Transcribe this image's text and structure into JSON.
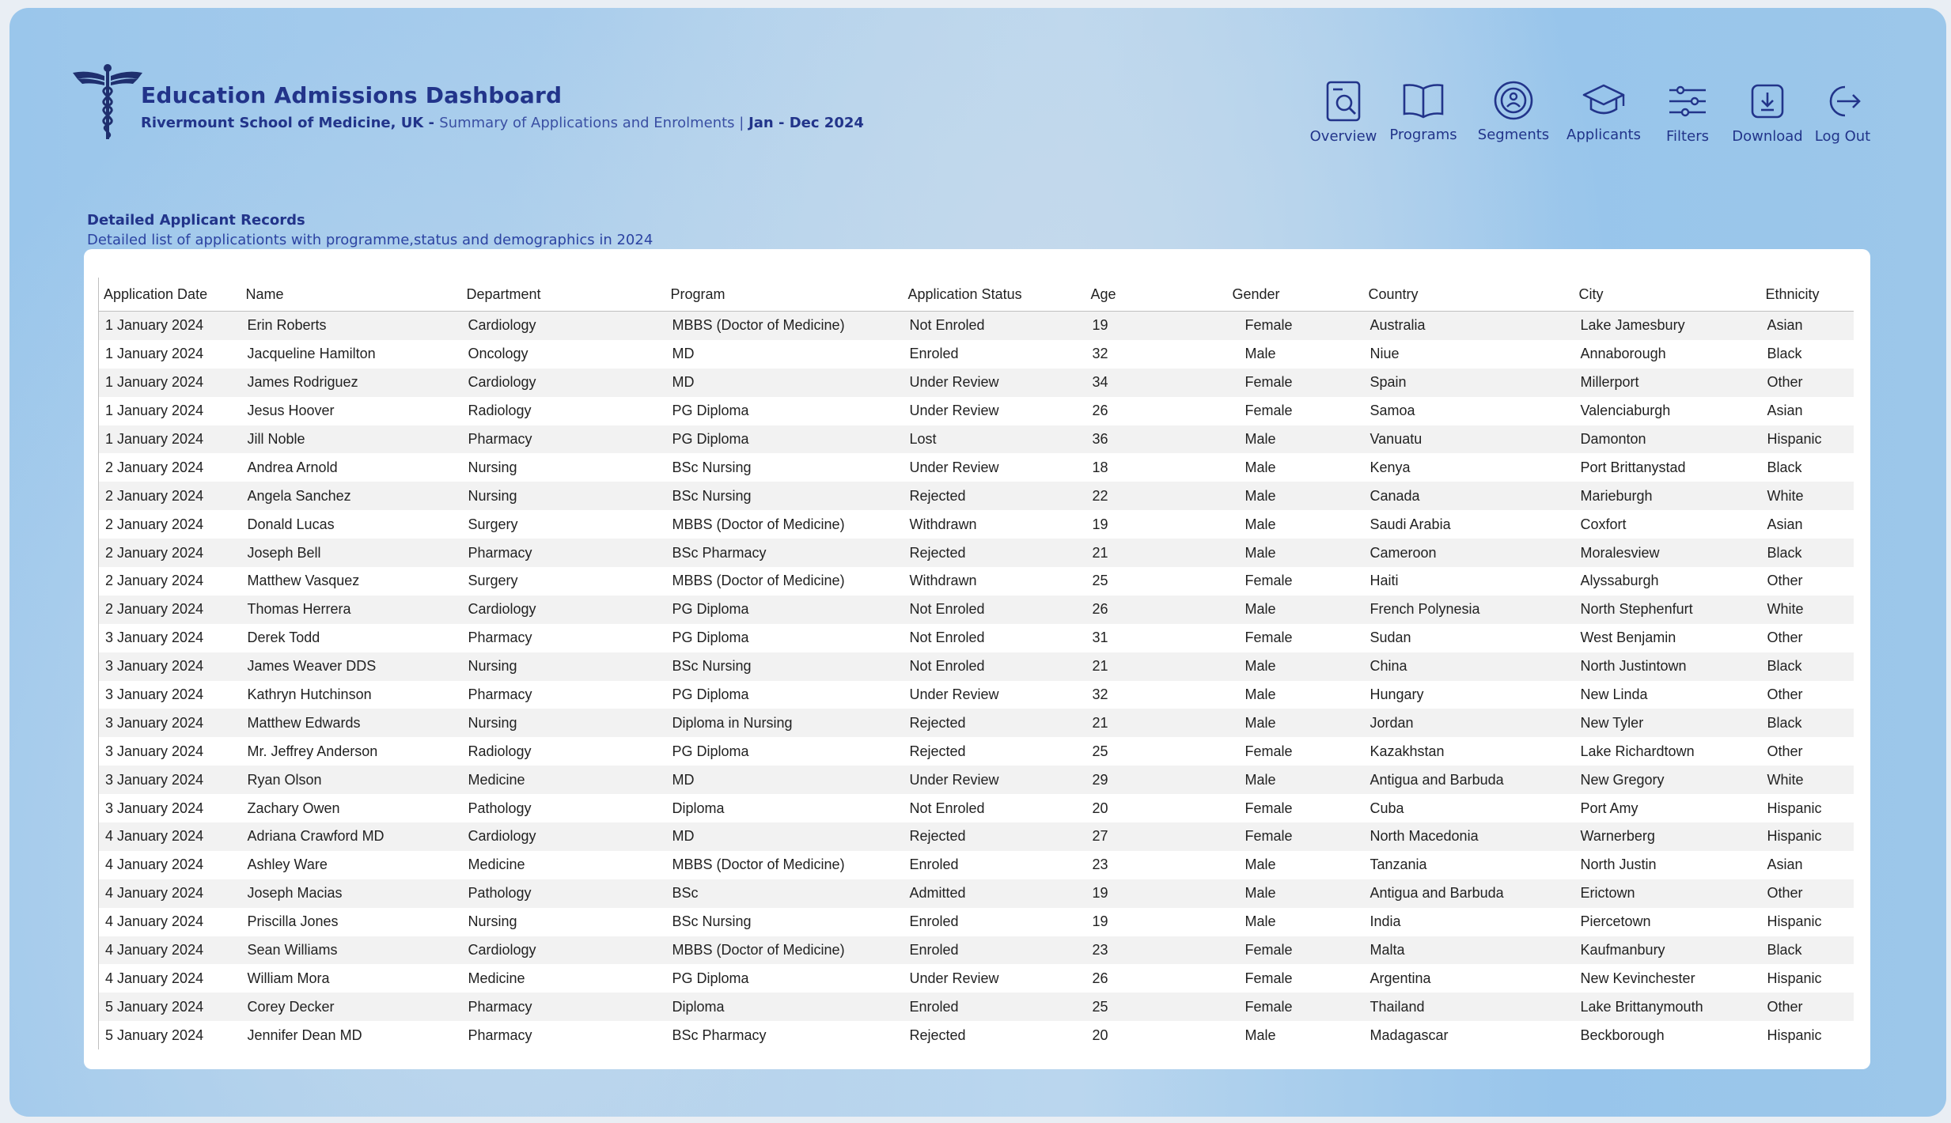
{
  "header": {
    "title": "Education Admissions Dashboard",
    "school": "Rivermount School of Medicine, UK - ",
    "summary": "Summary of Applications and Enrolments | ",
    "period": "Jan - Dec 2024"
  },
  "nav": {
    "overview": "Overview",
    "programs": "Programs",
    "segments": "Segments",
    "applicants": "Applicants",
    "filters": "Filters",
    "download": "Download",
    "logout": "Log Out"
  },
  "section": {
    "title": "Detailed Applicant Records",
    "subtitle": "Detailed list of applicationts with programme,status and demographics in 2024"
  },
  "table": {
    "columns": [
      "Application Date",
      "Name",
      "Department",
      "Program",
      "Application Status",
      "Age",
      "Gender",
      "Country",
      "City",
      "Ethnicity"
    ],
    "rows": [
      [
        "1 January 2024",
        "Erin Roberts",
        "Cardiology",
        "MBBS (Doctor of Medicine)",
        "Not Enroled",
        "19",
        "Female",
        "Australia",
        "Lake Jamesbury",
        "Asian"
      ],
      [
        "1 January 2024",
        "Jacqueline Hamilton",
        "Oncology",
        "MD",
        "Enroled",
        "32",
        "Male",
        "Niue",
        "Annaborough",
        "Black"
      ],
      [
        "1 January 2024",
        "James Rodriguez",
        "Cardiology",
        "MD",
        "Under Review",
        "34",
        "Female",
        "Spain",
        "Millerport",
        "Other"
      ],
      [
        "1 January 2024",
        "Jesus Hoover",
        "Radiology",
        "PG Diploma",
        "Under Review",
        "26",
        "Female",
        "Samoa",
        "Valenciaburgh",
        "Asian"
      ],
      [
        "1 January 2024",
        "Jill Noble",
        "Pharmacy",
        "PG Diploma",
        "Lost",
        "36",
        "Male",
        "Vanuatu",
        "Damonton",
        "Hispanic"
      ],
      [
        "2 January 2024",
        "Andrea Arnold",
        "Nursing",
        "BSc Nursing",
        "Under Review",
        "18",
        "Male",
        "Kenya",
        "Port Brittanystad",
        "Black"
      ],
      [
        "2 January 2024",
        "Angela Sanchez",
        "Nursing",
        "BSc Nursing",
        "Rejected",
        "22",
        "Male",
        "Canada",
        "Marieburgh",
        "White"
      ],
      [
        "2 January 2024",
        "Donald Lucas",
        "Surgery",
        "MBBS (Doctor of Medicine)",
        "Withdrawn",
        "19",
        "Male",
        "Saudi Arabia",
        "Coxfort",
        "Asian"
      ],
      [
        "2 January 2024",
        "Joseph Bell",
        "Pharmacy",
        "BSc Pharmacy",
        "Rejected",
        "21",
        "Male",
        "Cameroon",
        "Moralesview",
        "Black"
      ],
      [
        "2 January 2024",
        "Matthew Vasquez",
        "Surgery",
        "MBBS (Doctor of Medicine)",
        "Withdrawn",
        "25",
        "Female",
        "Haiti",
        "Alyssaburgh",
        "Other"
      ],
      [
        "2 January 2024",
        "Thomas Herrera",
        "Cardiology",
        "PG Diploma",
        "Not Enroled",
        "26",
        "Male",
        "French Polynesia",
        "North Stephenfurt",
        "White"
      ],
      [
        "3 January 2024",
        "Derek Todd",
        "Pharmacy",
        "PG Diploma",
        "Not Enroled",
        "31",
        "Female",
        "Sudan",
        "West Benjamin",
        "Other"
      ],
      [
        "3 January 2024",
        "James Weaver DDS",
        "Nursing",
        "BSc Nursing",
        "Not Enroled",
        "21",
        "Male",
        "China",
        "North Justintown",
        "Black"
      ],
      [
        "3 January 2024",
        "Kathryn Hutchinson",
        "Pharmacy",
        "PG Diploma",
        "Under Review",
        "32",
        "Male",
        "Hungary",
        "New Linda",
        "Other"
      ],
      [
        "3 January 2024",
        "Matthew Edwards",
        "Nursing",
        "Diploma in Nursing",
        "Rejected",
        "21",
        "Male",
        "Jordan",
        "New Tyler",
        "Black"
      ],
      [
        "3 January 2024",
        "Mr. Jeffrey Anderson",
        "Radiology",
        "PG Diploma",
        "Rejected",
        "25",
        "Female",
        "Kazakhstan",
        "Lake Richardtown",
        "Other"
      ],
      [
        "3 January 2024",
        "Ryan Olson",
        "Medicine",
        "MD",
        "Under Review",
        "29",
        "Male",
        "Antigua and Barbuda",
        "New Gregory",
        "White"
      ],
      [
        "3 January 2024",
        "Zachary Owen",
        "Pathology",
        "Diploma",
        "Not Enroled",
        "20",
        "Female",
        "Cuba",
        "Port Amy",
        "Hispanic"
      ],
      [
        "4 January 2024",
        "Adriana Crawford MD",
        "Cardiology",
        "MD",
        "Rejected",
        "27",
        "Female",
        "North Macedonia",
        "Warnerberg",
        "Hispanic"
      ],
      [
        "4 January 2024",
        "Ashley Ware",
        "Medicine",
        "MBBS (Doctor of Medicine)",
        "Enroled",
        "23",
        "Male",
        "Tanzania",
        "North Justin",
        "Asian"
      ],
      [
        "4 January 2024",
        "Joseph Macias",
        "Pathology",
        "BSc",
        "Admitted",
        "19",
        "Male",
        "Antigua and Barbuda",
        "Erictown",
        "Other"
      ],
      [
        "4 January 2024",
        "Priscilla Jones",
        "Nursing",
        "BSc Nursing",
        "Enroled",
        "19",
        "Male",
        "India",
        "Piercetown",
        "Hispanic"
      ],
      [
        "4 January 2024",
        "Sean Williams",
        "Cardiology",
        "MBBS (Doctor of Medicine)",
        "Enroled",
        "23",
        "Female",
        "Malta",
        "Kaufmanbury",
        "Black"
      ],
      [
        "4 January 2024",
        "William Mora",
        "Medicine",
        "PG Diploma",
        "Under Review",
        "26",
        "Female",
        "Argentina",
        "New Kevinchester",
        "Hispanic"
      ],
      [
        "5 January 2024",
        "Corey Decker",
        "Pharmacy",
        "Diploma",
        "Enroled",
        "25",
        "Female",
        "Thailand",
        "Lake Brittanymouth",
        "Other"
      ],
      [
        "5 January 2024",
        "Jennifer Dean MD",
        "Pharmacy",
        "BSc Pharmacy",
        "Rejected",
        "20",
        "Male",
        "Madagascar",
        "Beckborough",
        "Hispanic"
      ]
    ]
  }
}
